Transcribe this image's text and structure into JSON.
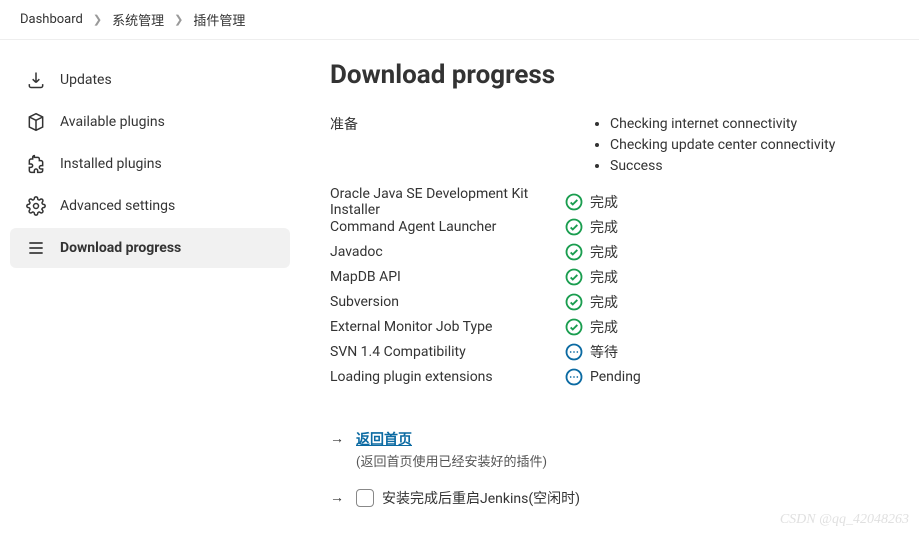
{
  "breadcrumb": [
    {
      "label": "Dashboard"
    },
    {
      "label": "系统管理"
    },
    {
      "label": "插件管理"
    }
  ],
  "sidebar": {
    "items": [
      {
        "label": "Updates",
        "icon": "download-icon"
      },
      {
        "label": "Available plugins",
        "icon": "package-icon"
      },
      {
        "label": "Installed plugins",
        "icon": "puzzle-icon"
      },
      {
        "label": "Advanced settings",
        "icon": "gear-icon"
      },
      {
        "label": "Download progress",
        "icon": "list-icon",
        "active": true
      }
    ]
  },
  "main": {
    "title": "Download progress",
    "preparation": {
      "label": "准备",
      "checks": [
        "Checking internet connectivity",
        "Checking update center connectivity",
        "Success"
      ]
    },
    "tasks": [
      {
        "name": "Oracle Java SE Development Kit Installer",
        "status": "完成",
        "state": "success"
      },
      {
        "name": "Command Agent Launcher",
        "status": "完成",
        "state": "success"
      },
      {
        "name": "Javadoc",
        "status": "完成",
        "state": "success"
      },
      {
        "name": "MapDB API",
        "status": "完成",
        "state": "success"
      },
      {
        "name": "Subversion",
        "status": "完成",
        "state": "success"
      },
      {
        "name": "External Monitor Job Type",
        "status": "完成",
        "state": "success"
      },
      {
        "name": "SVN 1.4 Compatibility",
        "status": "等待",
        "state": "pending"
      },
      {
        "name": "Loading plugin extensions",
        "status": "Pending",
        "state": "pending"
      }
    ],
    "footer": {
      "back_link": "返回首页",
      "back_hint": "(返回首页使用已经安装好的插件)",
      "restart_label": "安装完成后重启Jenkins(空闲时)"
    }
  },
  "watermark": "CSDN @qq_42048263"
}
